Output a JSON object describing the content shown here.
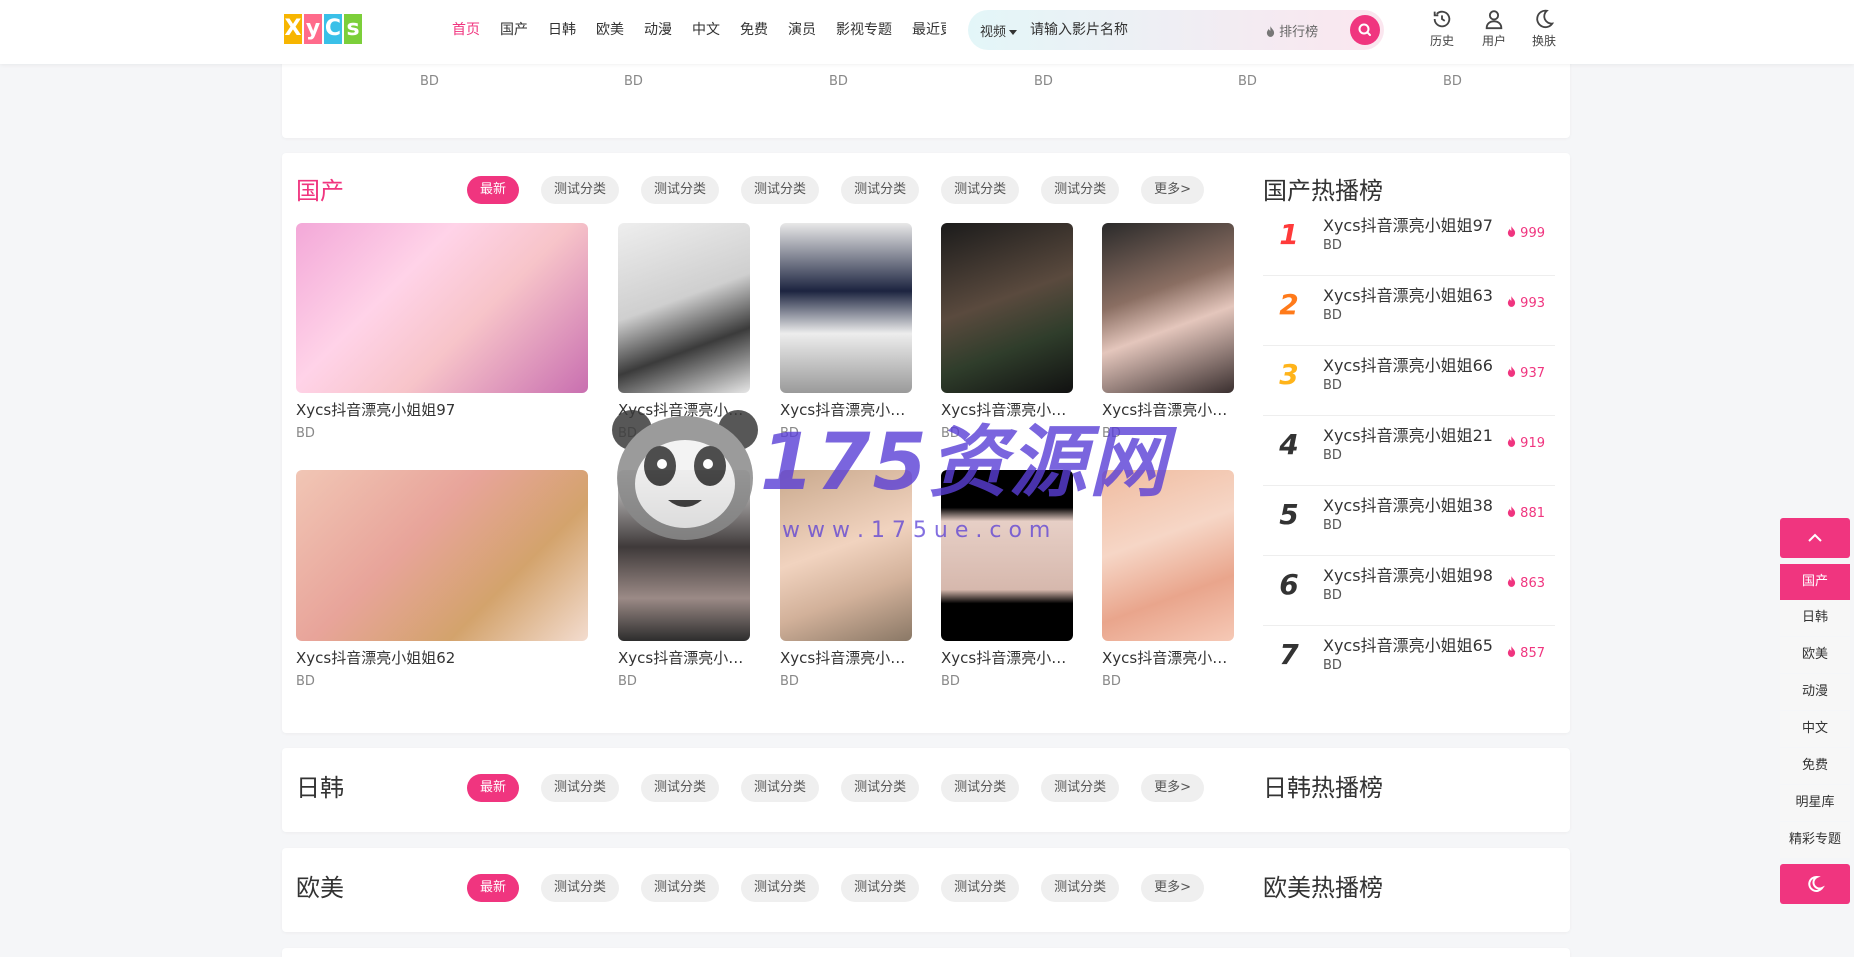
{
  "header": {
    "logo_letters": [
      "X",
      "y",
      "C",
      "s"
    ],
    "logo_colors": [
      "#f7b500",
      "#ff6b8b",
      "#3ac0e8",
      "#7ccf3a"
    ],
    "nav": [
      "首页",
      "国产",
      "日韩",
      "欧美",
      "动漫",
      "中文",
      "免费",
      "演员",
      "影视专题",
      "最近更新"
    ],
    "search_type": "视频",
    "search_placeholder": "请输入影片名称",
    "rank_link": "排行榜",
    "tools": [
      {
        "icon": "history-icon",
        "label": "历史"
      },
      {
        "icon": "user-icon",
        "label": "用户"
      },
      {
        "icon": "moon-icon",
        "label": "换肤"
      }
    ]
  },
  "top_row_quality": [
    "BD",
    "BD",
    "BD",
    "BD",
    "BD",
    "BD"
  ],
  "sections": [
    {
      "title": "国产",
      "tags": [
        "最新",
        "测试分类",
        "测试分类",
        "测试分类",
        "测试分类",
        "测试分类",
        "测试分类",
        "更多>"
      ],
      "rank_title": "国产热播榜",
      "videos": [
        {
          "title": "Xycs抖音漂亮小姐姐97",
          "quality": "BD"
        },
        {
          "title": "Xycs抖音漂亮小姐姐...",
          "quality": "BD"
        },
        {
          "title": "Xycs抖音漂亮小姐姐...",
          "quality": "BD"
        },
        {
          "title": "Xycs抖音漂亮小姐姐...",
          "quality": "BD"
        },
        {
          "title": "Xycs抖音漂亮小姐姐...",
          "quality": "BD"
        },
        {
          "title": "Xycs抖音漂亮小姐姐62",
          "quality": "BD"
        },
        {
          "title": "Xycs抖音漂亮小姐姐...",
          "quality": "BD"
        },
        {
          "title": "Xycs抖音漂亮小姐姐...",
          "quality": "BD"
        },
        {
          "title": "Xycs抖音漂亮小姐姐...",
          "quality": "BD"
        },
        {
          "title": "Xycs抖音漂亮小姐姐...",
          "quality": "BD"
        }
      ],
      "rank": [
        {
          "num": "1",
          "title": "Xycs抖音漂亮小姐姐97",
          "quality": "BD",
          "heat": "999"
        },
        {
          "num": "2",
          "title": "Xycs抖音漂亮小姐姐63",
          "quality": "BD",
          "heat": "993"
        },
        {
          "num": "3",
          "title": "Xycs抖音漂亮小姐姐66",
          "quality": "BD",
          "heat": "937"
        },
        {
          "num": "4",
          "title": "Xycs抖音漂亮小姐姐21",
          "quality": "BD",
          "heat": "919"
        },
        {
          "num": "5",
          "title": "Xycs抖音漂亮小姐姐38",
          "quality": "BD",
          "heat": "881"
        },
        {
          "num": "6",
          "title": "Xycs抖音漂亮小姐姐98",
          "quality": "BD",
          "heat": "863"
        },
        {
          "num": "7",
          "title": "Xycs抖音漂亮小姐姐65",
          "quality": "BD",
          "heat": "857"
        }
      ]
    },
    {
      "title": "日韩",
      "tags": [
        "最新",
        "测试分类",
        "测试分类",
        "测试分类",
        "测试分类",
        "测试分类",
        "测试分类",
        "更多>"
      ],
      "rank_title": "日韩热播榜"
    },
    {
      "title": "欧美",
      "tags": [
        "最新",
        "测试分类",
        "测试分类",
        "测试分类",
        "测试分类",
        "测试分类",
        "测试分类",
        "更多>"
      ],
      "rank_title": "欧美热播榜"
    }
  ],
  "side_menu": [
    "国产",
    "日韩",
    "欧美",
    "动漫",
    "中文",
    "免费",
    "明星库",
    "精彩专题"
  ],
  "watermark": {
    "title": "175资源网",
    "url": "w w w . 1 7 5 u e . c o m"
  },
  "colors": {
    "accent": "#f0357f"
  }
}
